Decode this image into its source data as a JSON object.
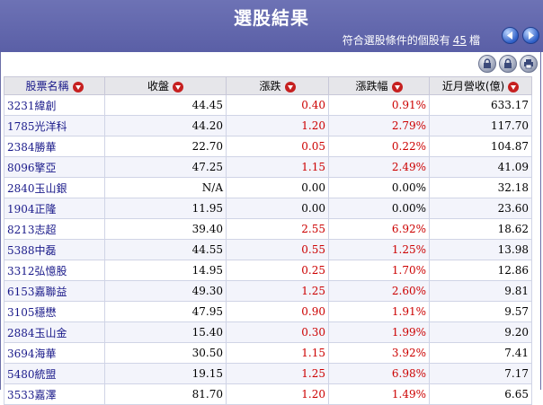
{
  "page": {
    "title": "選股結果",
    "count_prefix": "符合選股條件的個股有",
    "count_value": "45",
    "count_suffix": "檔"
  },
  "colors": {
    "header_bg": "#5a5fa6",
    "up_red": "#cc0000",
    "sort_icon": "#c62020"
  },
  "icons": {
    "prev": "left-arrow-icon",
    "next": "right-arrow-icon",
    "tools": [
      "lock-icon",
      "lock-icon",
      "print-icon"
    ]
  },
  "table": {
    "headers": [
      "股票名稱",
      "收盤",
      "漲跌",
      "漲跌幅",
      "近月營收(億)"
    ],
    "rows": [
      {
        "name": "3231緯創",
        "close": "44.45",
        "change": "0.40",
        "pct": "0.91%",
        "revenue": "633.17",
        "up": true
      },
      {
        "name": "1785光洋科",
        "close": "44.20",
        "change": "1.20",
        "pct": "2.79%",
        "revenue": "117.70",
        "up": true
      },
      {
        "name": "2384勝華",
        "close": "22.70",
        "change": "0.05",
        "pct": "0.22%",
        "revenue": "104.87",
        "up": true
      },
      {
        "name": "8096擎亞",
        "close": "47.25",
        "change": "1.15",
        "pct": "2.49%",
        "revenue": "41.09",
        "up": true
      },
      {
        "name": "2840玉山銀",
        "close": "N/A",
        "change": "0.00",
        "pct": "0.00%",
        "revenue": "32.18",
        "up": false
      },
      {
        "name": "1904正隆",
        "close": "11.95",
        "change": "0.00",
        "pct": "0.00%",
        "revenue": "23.60",
        "up": false
      },
      {
        "name": "8213志超",
        "close": "39.40",
        "change": "2.55",
        "pct": "6.92%",
        "revenue": "18.62",
        "up": true
      },
      {
        "name": "5388中磊",
        "close": "44.55",
        "change": "0.55",
        "pct": "1.25%",
        "revenue": "13.98",
        "up": true
      },
      {
        "name": "3312弘憶股",
        "close": "14.95",
        "change": "0.25",
        "pct": "1.70%",
        "revenue": "12.86",
        "up": true
      },
      {
        "name": "6153嘉聯益",
        "close": "49.30",
        "change": "1.25",
        "pct": "2.60%",
        "revenue": "9.81",
        "up": true
      },
      {
        "name": "3105穩懋",
        "close": "47.95",
        "change": "0.90",
        "pct": "1.91%",
        "revenue": "9.57",
        "up": true
      },
      {
        "name": "2884玉山金",
        "close": "15.40",
        "change": "0.30",
        "pct": "1.99%",
        "revenue": "9.20",
        "up": true
      },
      {
        "name": "3694海華",
        "close": "30.50",
        "change": "1.15",
        "pct": "3.92%",
        "revenue": "7.41",
        "up": true
      },
      {
        "name": "5480統盟",
        "close": "19.15",
        "change": "1.25",
        "pct": "6.98%",
        "revenue": "7.17",
        "up": true
      },
      {
        "name": "3533嘉澤",
        "close": "81.70",
        "change": "1.20",
        "pct": "1.49%",
        "revenue": "6.65",
        "up": true
      }
    ]
  }
}
